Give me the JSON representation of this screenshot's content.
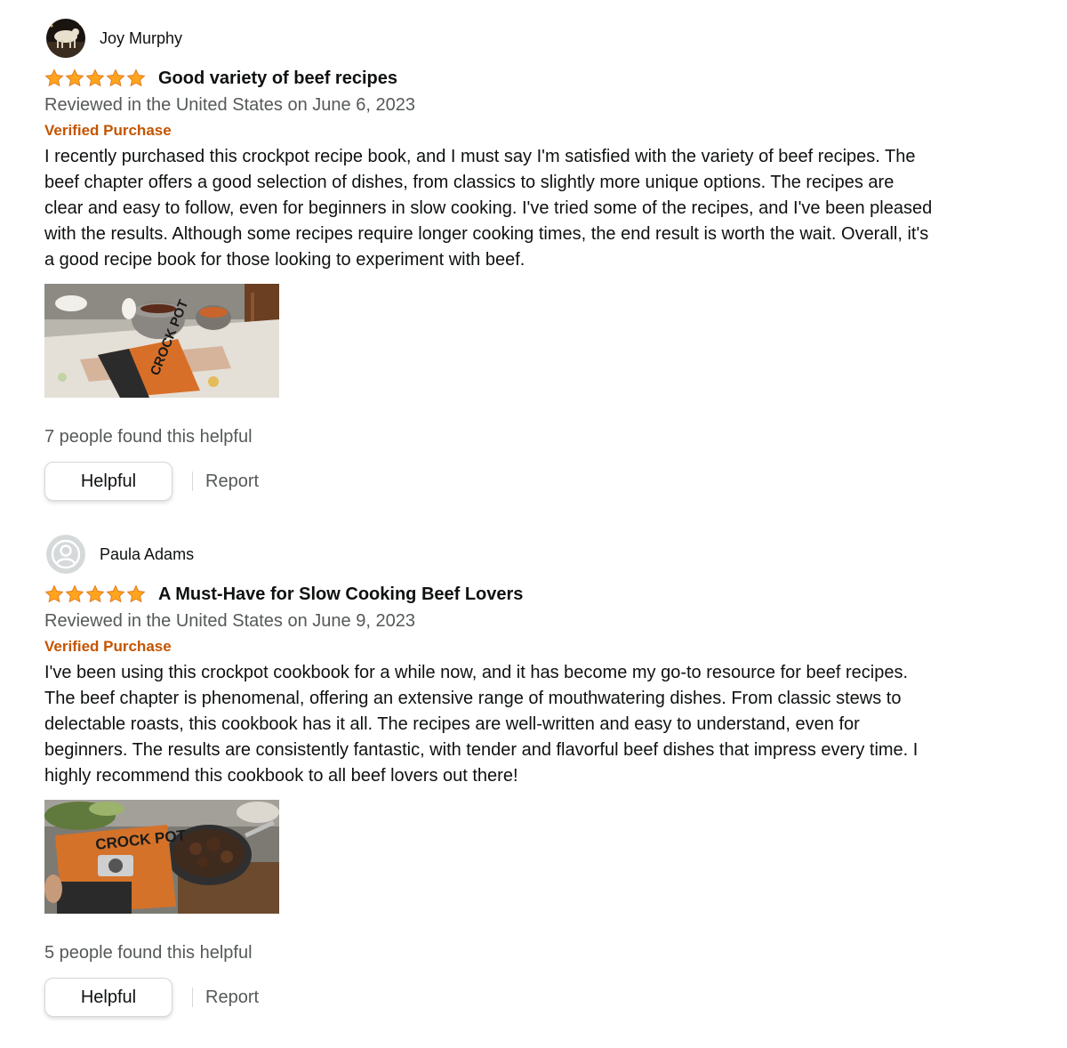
{
  "colors": {
    "text": "#0f1111",
    "muted": "#565959",
    "verified": "#c45500",
    "star": "#ffa41c",
    "button_border": "#d5d9d9"
  },
  "reviews": [
    {
      "profile_name": "Joy Murphy",
      "avatar_icon": "custom-photo-avatar",
      "rating": 5,
      "title": "Good variety of beef recipes",
      "date": "Reviewed in the United States on June 6, 2023",
      "verified": "Verified Purchase",
      "body": "I recently purchased this crockpot recipe book, and I must say I'm satisfied with the variety of beef recipes. The beef chapter offers a good selection of dishes, from classics to slightly more unique options. The recipes are clear and easy to follow, even for beginners in slow cooking. I've tried some of the recipes, and I've been pleased with the results. Although some recipes require longer cooking times, the end result is worth the wait. Overall, it's a good recipe book for those looking to experiment with beef.",
      "photo_text": "CROCK POT",
      "helpful_count": "7 people found this helpful",
      "helpful_label": "Helpful",
      "report_label": "Report"
    },
    {
      "profile_name": "Paula Adams",
      "avatar_icon": "default-user-avatar",
      "rating": 5,
      "title": "A Must-Have for Slow Cooking Beef Lovers",
      "date": "Reviewed in the United States on June 9, 2023",
      "verified": "Verified Purchase",
      "body": "I've been using this crockpot cookbook for a while now, and it has become my go-to resource for beef recipes. The beef chapter is phenomenal, offering an extensive range of mouthwatering dishes. From classic stews to delectable roasts, this cookbook has it all. The recipes are well-written and easy to understand, even for beginners. The results are consistently fantastic, with tender and flavorful beef dishes that impress every time. I highly recommend this cookbook to all beef lovers out there!",
      "photo_text": "CROCK POT",
      "helpful_count": "5 people found this helpful",
      "helpful_label": "Helpful",
      "report_label": "Report"
    }
  ]
}
